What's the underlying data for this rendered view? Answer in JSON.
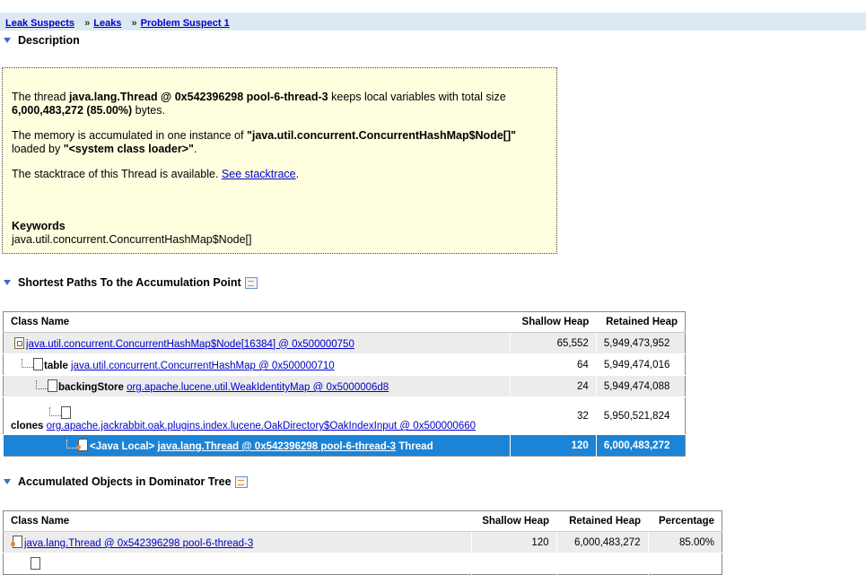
{
  "breadcrumb": {
    "items": [
      "Leak Suspects",
      "Leaks",
      "Problem Suspect 1"
    ],
    "separator": "»"
  },
  "description": {
    "heading": "Description",
    "line1_prefix": "The thread ",
    "line1_bold": "java.lang.Thread @ 0x542396298 pool-6-thread-3",
    "line1_suffix": " keeps local variables with total size",
    "line2_bold": "6,000,483,272 (85.00%)",
    "line2_suffix": " bytes.",
    "line3_prefix": "The memory is accumulated in one instance of ",
    "line3_bold": "\"java.util.concurrent.ConcurrentHashMap$Node[]\"",
    "line4_prefix": "loaded by ",
    "line4_bold": "\"<system class loader>\"",
    "line4_suffix": ".",
    "line5_prefix": "The stacktrace of this Thread is available. ",
    "line5_link": "See stacktrace",
    "line5_suffix": ".",
    "keywords_label": "Keywords",
    "keywords_value": "java.util.concurrent.ConcurrentHashMap$Node[]"
  },
  "shortest_paths": {
    "heading": "Shortest Paths To the Accumulation Point",
    "icon": "table-icon",
    "columns": [
      "Class Name",
      "Shallow Heap",
      "Retained Heap"
    ],
    "rows": [
      {
        "prefix": "",
        "link": "java.util.concurrent.ConcurrentHashMap$Node[16384] @ 0x500000750",
        "suffix": "",
        "shallow": "65,552",
        "retained": "5,949,473,952"
      },
      {
        "prefix": "table ",
        "link": "java.util.concurrent.ConcurrentHashMap @ 0x500000710",
        "suffix": "",
        "shallow": "64",
        "retained": "5,949,474,016"
      },
      {
        "prefix": "backingStore ",
        "link": "org.apache.lucene.util.WeakIdentityMap @ 0x5000006d8",
        "suffix": "",
        "shallow": "24",
        "retained": "5,949,474,088"
      },
      {
        "prefix": "clones ",
        "link": "org.apache.jackrabbit.oak.plugins.index.lucene.OakDirectory$OakIndexInput @ 0x500000660",
        "suffix": "",
        "shallow": "32",
        "retained": "5,950,521,824"
      },
      {
        "prefix": "<Java Local> ",
        "link": "java.lang.Thread @ 0x542396298 pool-6-thread-3",
        "suffix": " Thread",
        "shallow": "120",
        "retained": "6,000,483,272"
      }
    ]
  },
  "accumulated": {
    "heading": "Accumulated Objects in Dominator Tree",
    "icon": "table-icon",
    "columns": [
      "Class Name",
      "Shallow Heap",
      "Retained Heap",
      "Percentage"
    ],
    "rows": [
      {
        "link": "java.lang.Thread @ 0x542396298 pool-6-thread-3",
        "shallow": "120",
        "retained": "6,000,483,272",
        "percentage": "85.00%"
      }
    ]
  }
}
